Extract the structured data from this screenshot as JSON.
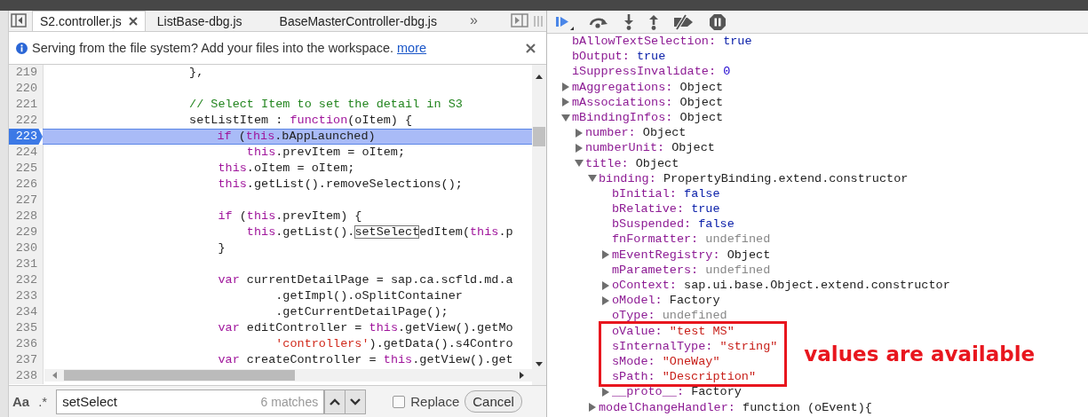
{
  "sources_panel": {
    "tabs": [
      {
        "label": "S2.controller.js",
        "selected": true
      },
      {
        "label": "ListBase-dbg.js",
        "selected": false
      },
      {
        "label": "BaseMasterController-dbg.js",
        "selected": false
      }
    ],
    "overflow_label": "»",
    "info_bar": {
      "message": "Serving from the file system? Add your files into the workspace.",
      "link": "more"
    },
    "code_lines": [
      {
        "number": "219",
        "current": false,
        "segments": [
          {
            "kind": "plain",
            "text": "                    },"
          }
        ]
      },
      {
        "number": "220",
        "current": false
      },
      {
        "number": "221",
        "current": false,
        "segments": [
          {
            "kind": "comment",
            "text": "                    // Select Item to set the detail in S3"
          }
        ]
      },
      {
        "number": "222",
        "current": false,
        "segments": [
          {
            "kind": "plain",
            "text": "                    setListItem : "
          },
          {
            "kind": "keyword",
            "text": "function"
          },
          {
            "kind": "plain",
            "text": "(oItem) {"
          }
        ]
      },
      {
        "number": "223",
        "current": true,
        "segments": [
          {
            "kind": "keyword",
            "text": "                        if"
          },
          {
            "kind": "plain",
            "text": " ("
          },
          {
            "kind": "keyword",
            "text": "this"
          },
          {
            "kind": "plain",
            "text": ".bAppLaunched)"
          }
        ]
      },
      {
        "number": "224",
        "current": false,
        "segments": [
          {
            "kind": "keyword",
            "text": "                            this"
          },
          {
            "kind": "plain",
            "text": ".prevItem = oItem;"
          }
        ]
      },
      {
        "number": "225",
        "current": false,
        "segments": [
          {
            "kind": "keyword",
            "text": "                        this"
          },
          {
            "kind": "plain",
            "text": ".oItem = oItem;"
          }
        ]
      },
      {
        "number": "226",
        "current": false,
        "segments": [
          {
            "kind": "keyword",
            "text": "                        this"
          },
          {
            "kind": "plain",
            "text": ".getList().removeSelections();"
          }
        ]
      },
      {
        "number": "227",
        "current": false
      },
      {
        "number": "228",
        "current": false,
        "segments": [
          {
            "kind": "keyword",
            "text": "                        if"
          },
          {
            "kind": "plain",
            "text": " ("
          },
          {
            "kind": "keyword",
            "text": "this"
          },
          {
            "kind": "plain",
            "text": ".prevItem) {"
          }
        ]
      },
      {
        "number": "229",
        "current": false,
        "segments": [
          {
            "kind": "keyword",
            "text": "                            this"
          },
          {
            "kind": "plain",
            "text": ".getList()."
          },
          {
            "kind": "match",
            "text": "setSelect"
          },
          {
            "kind": "plain",
            "text": "edItem("
          },
          {
            "kind": "keyword",
            "text": "this"
          },
          {
            "kind": "plain",
            "text": ".p"
          }
        ]
      },
      {
        "number": "230",
        "current": false,
        "segments": [
          {
            "kind": "plain",
            "text": "                        }"
          }
        ]
      },
      {
        "number": "231",
        "current": false
      },
      {
        "number": "232",
        "current": false,
        "segments": [
          {
            "kind": "keyword",
            "text": "                        var"
          },
          {
            "kind": "plain",
            "text": " currentDetailPage = sap.ca.scfld.md.a"
          }
        ]
      },
      {
        "number": "233",
        "current": false,
        "segments": [
          {
            "kind": "plain",
            "text": "                                .getImpl().oSplitContainer"
          }
        ]
      },
      {
        "number": "234",
        "current": false,
        "segments": [
          {
            "kind": "plain",
            "text": "                                .getCurrentDetailPage();"
          }
        ]
      },
      {
        "number": "235",
        "current": false,
        "segments": [
          {
            "kind": "keyword",
            "text": "                        var"
          },
          {
            "kind": "plain",
            "text": " editController = "
          },
          {
            "kind": "keyword",
            "text": "this"
          },
          {
            "kind": "plain",
            "text": ".getView().getMo"
          }
        ]
      },
      {
        "number": "236",
        "current": false,
        "segments": [
          {
            "kind": "string",
            "text": "                                'controllers'"
          },
          {
            "kind": "plain",
            "text": ").getData().s4Contro"
          }
        ]
      },
      {
        "number": "237",
        "current": false,
        "segments": [
          {
            "kind": "keyword",
            "text": "                        var"
          },
          {
            "kind": "plain",
            "text": " createController = "
          },
          {
            "kind": "keyword",
            "text": "this"
          },
          {
            "kind": "plain",
            "text": ".getView().get"
          }
        ]
      },
      {
        "number": "238",
        "current": false
      }
    ],
    "search_bar": {
      "case_label": "Aa",
      "regex_label": ".*",
      "query": "setSelect",
      "match_count": "6 matches",
      "replace": {
        "label": "Replace",
        "checked": false
      },
      "cancel": "Cancel"
    }
  },
  "scope_panel": {
    "callout": "values are available",
    "tree": [
      {
        "name": "bAllowTextSelection:",
        "value": "true",
        "kind": "boolean"
      },
      {
        "name": "bOutput:",
        "value": "true",
        "kind": "boolean"
      },
      {
        "name": "iSuppressInvalidate:",
        "value": "0",
        "kind": "number"
      },
      {
        "name": "mAggregations:",
        "value": "Object",
        "kind": "object",
        "expanded": false
      },
      {
        "name": "mAssociations:",
        "value": "Object",
        "kind": "object",
        "expanded": false
      },
      {
        "name": "mBindingInfos:",
        "value": "Object",
        "kind": "object",
        "expanded": true,
        "children": [
          {
            "name": "number:",
            "value": "Object",
            "kind": "object",
            "expanded": false
          },
          {
            "name": "numberUnit:",
            "value": "Object",
            "kind": "object",
            "expanded": false
          },
          {
            "name": "title:",
            "value": "Object",
            "kind": "object",
            "expanded": true,
            "children": [
              {
                "name": "binding:",
                "value": "PropertyBinding.extend.constructor",
                "kind": "object",
                "expanded": true,
                "children": [
                  {
                    "name": "bInitial:",
                    "value": "false",
                    "kind": "boolean",
                    "boxed": false
                  },
                  {
                    "name": "bRelative:",
                    "value": "true",
                    "kind": "boolean",
                    "boxed": false
                  },
                  {
                    "name": "bSuspended:",
                    "value": "false",
                    "kind": "boolean",
                    "boxed": false
                  },
                  {
                    "name": "fnFormatter:",
                    "value": "undefined",
                    "kind": "undefined",
                    "boxed": false
                  },
                  {
                    "name": "mEventRegistry:",
                    "value": "Object",
                    "kind": "object",
                    "expanded": false,
                    "boxed": false
                  },
                  {
                    "name": "mParameters:",
                    "value": "undefined",
                    "kind": "undefined",
                    "boxed": false
                  },
                  {
                    "name": "oContext:",
                    "value": "sap.ui.base.Object.extend.constructor",
                    "kind": "object",
                    "expanded": false,
                    "boxed": false
                  },
                  {
                    "name": "oModel:",
                    "value": "Factory",
                    "kind": "object",
                    "expanded": false,
                    "boxed": false
                  },
                  {
                    "name": "oType:",
                    "value": "undefined",
                    "kind": "undefined",
                    "boxed": false
                  },
                  {
                    "name": "oValue:",
                    "value": "\"test MS\"",
                    "kind": "string",
                    "boxed": true
                  },
                  {
                    "name": "sInternalType:",
                    "value": "\"string\"",
                    "kind": "string",
                    "boxed": true
                  },
                  {
                    "name": "sMode:",
                    "value": "\"OneWay\"",
                    "kind": "string",
                    "boxed": true
                  },
                  {
                    "name": "sPath:",
                    "value": "\"Description\"",
                    "kind": "string",
                    "boxed": true
                  },
                  {
                    "name": "__proto__:",
                    "value": "Factory",
                    "kind": "object",
                    "expanded": false,
                    "boxed": false
                  }
                ]
              },
              {
                "name": "modelChangeHandler:",
                "value": "function (oEvent){",
                "kind": "object",
                "expanded": false
              }
            ]
          }
        ]
      }
    ]
  }
}
